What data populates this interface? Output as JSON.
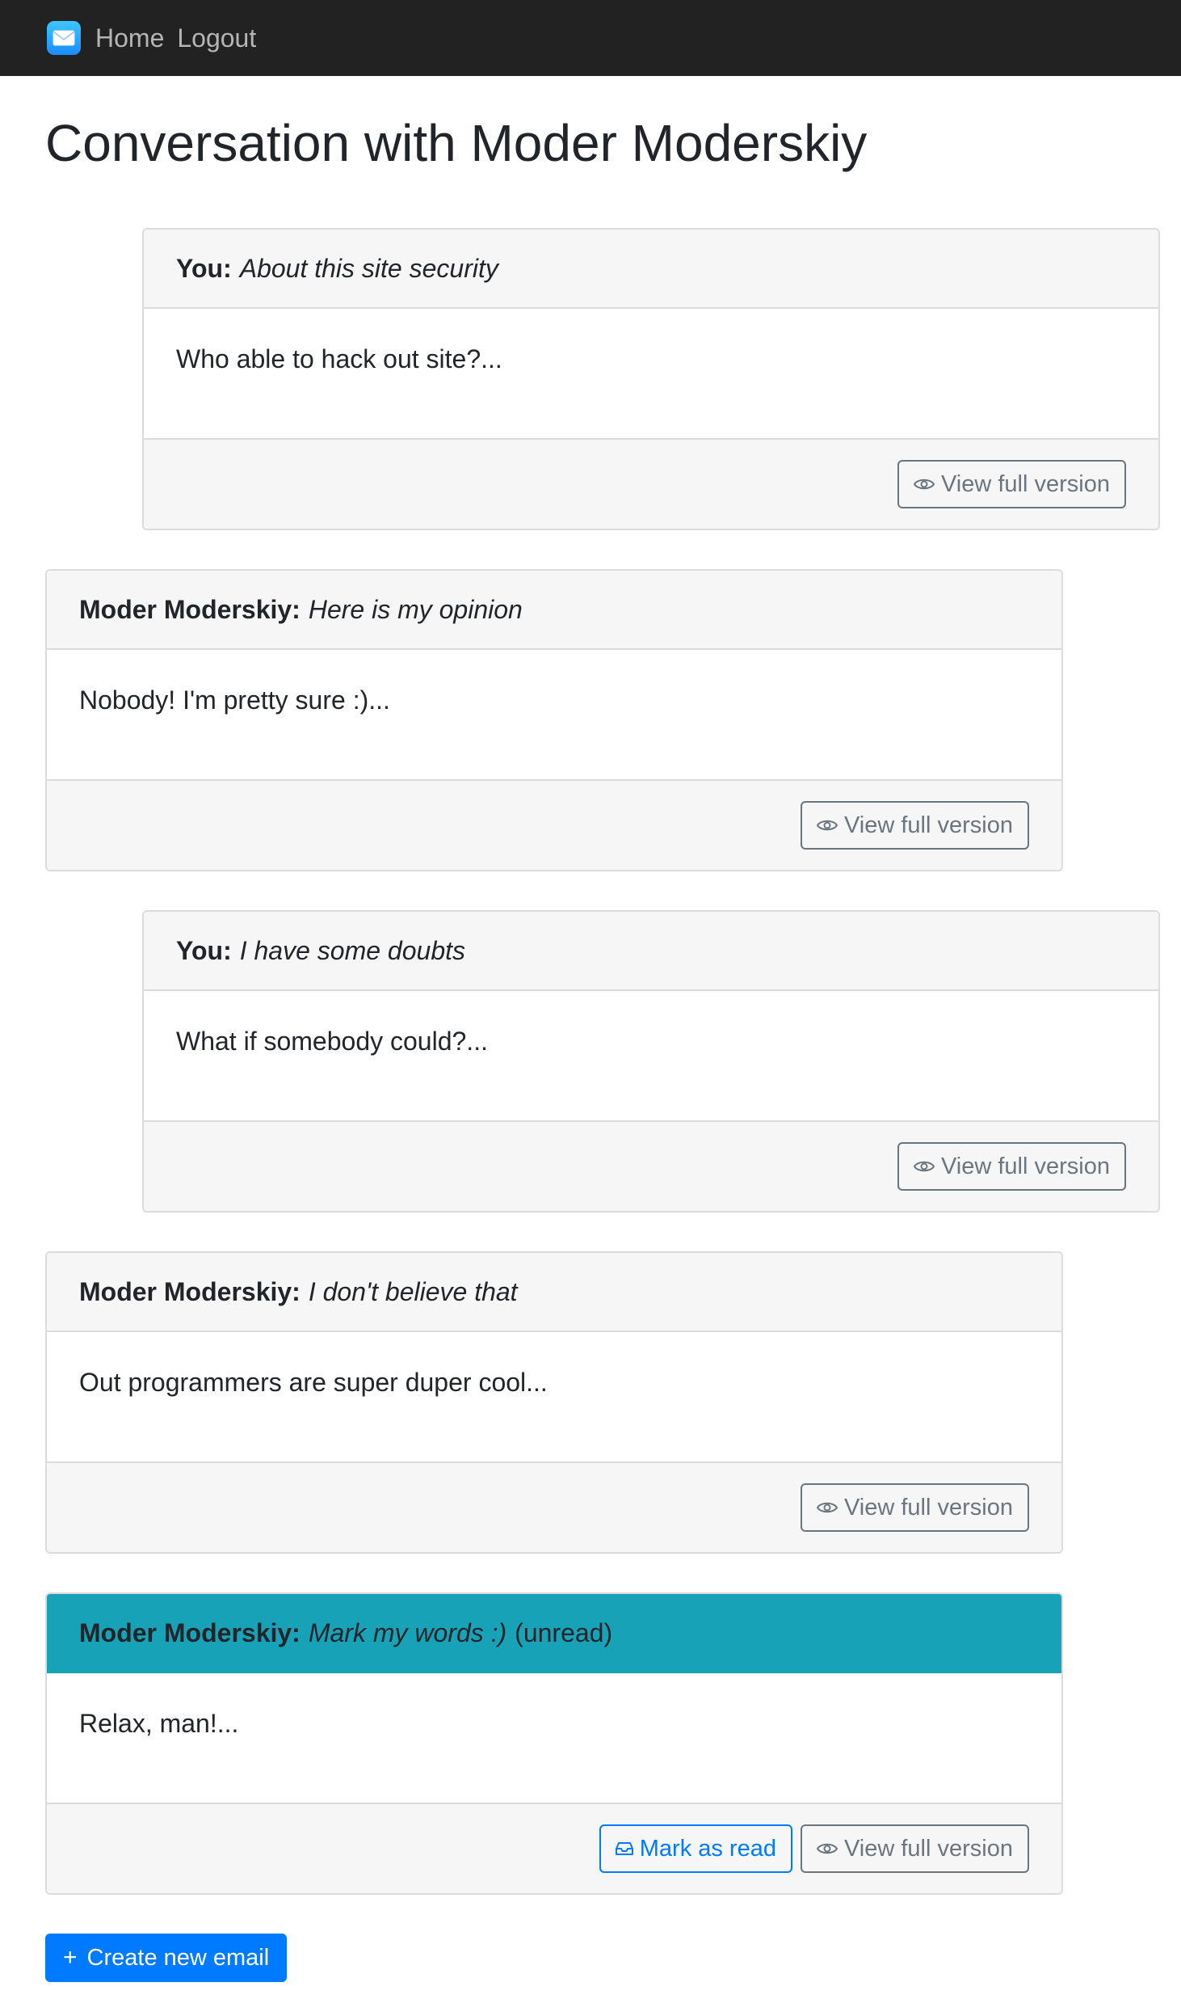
{
  "nav": {
    "brand_icon": "envelope-icon",
    "home_label": "Home",
    "logout_label": "Logout"
  },
  "page": {
    "title": "Conversation with Moder Moderskiy"
  },
  "messages": [
    {
      "sender": "You:",
      "subject": "About this site security",
      "status": "",
      "preview": "Who able to hack out site?...",
      "view_label": "View full version"
    },
    {
      "sender": "Moder Moderskiy:",
      "subject": "Here is my opinion",
      "status": "",
      "preview": "Nobody! I'm pretty sure :)...",
      "view_label": "View full version"
    },
    {
      "sender": "You:",
      "subject": "I have some doubts",
      "status": "",
      "preview": "What if somebody could?...",
      "view_label": "View full version"
    },
    {
      "sender": "Moder Moderskiy:",
      "subject": "I don't believe that",
      "status": "",
      "preview": "Out programmers are super duper cool...",
      "view_label": "View full version"
    },
    {
      "sender": "Moder Moderskiy:",
      "subject": "Mark my words :)",
      "status": "(unread)",
      "preview": "Relax, man!...",
      "mark_read_label": "Mark as read",
      "view_label": "View full version"
    }
  ],
  "actions": {
    "create_label": "Create new email"
  },
  "colors": {
    "navbar": "#222222",
    "unread_header": "#17a2b8",
    "primary": "#007bff",
    "secondary": "#6c757d"
  }
}
